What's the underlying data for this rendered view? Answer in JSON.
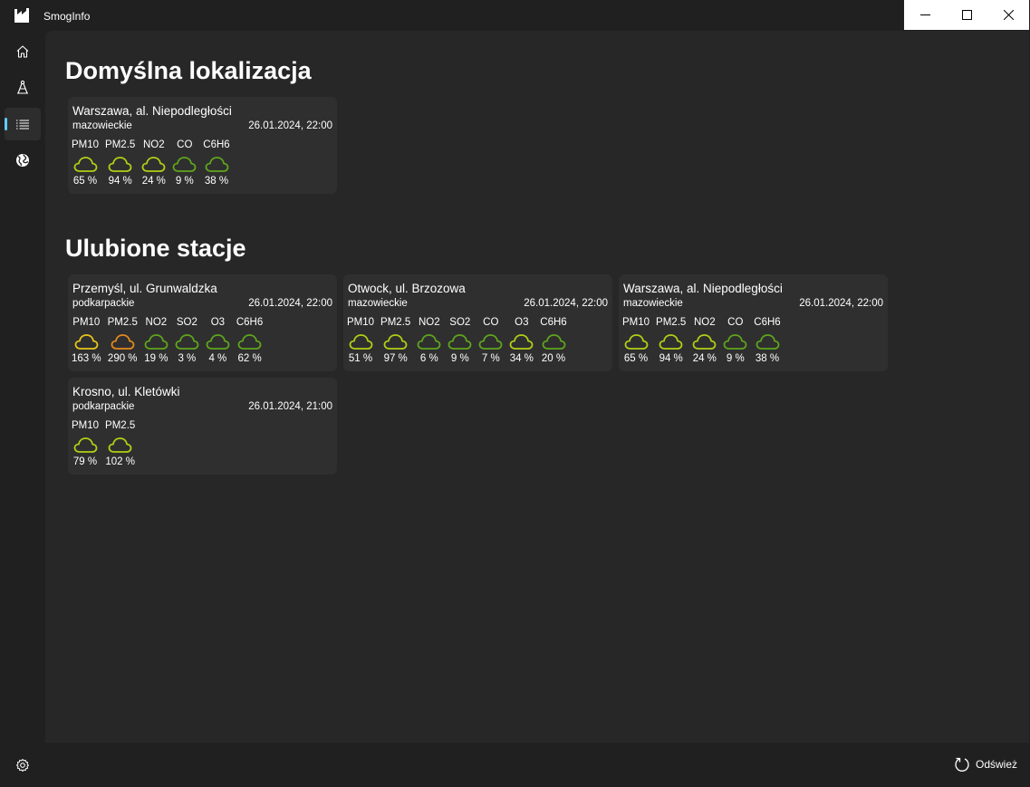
{
  "app": {
    "title": "SmogInfo"
  },
  "nav": [
    {
      "icon": "home-icon"
    },
    {
      "icon": "station-icon"
    },
    {
      "icon": "list-icon"
    },
    {
      "icon": "globe-icon"
    }
  ],
  "colors": {
    "accent": "#60cdff",
    "good": "#5fa51c",
    "moderate": "#b2ce16",
    "warning": "#e8c61a",
    "bad": "#e38a1c"
  },
  "default_section": {
    "title": "Domyślna lokalizacja",
    "cards": [
      {
        "name": "Warszawa, al. Niepodległości",
        "region": "mazowieckie",
        "time": "26.01.2024, 22:00",
        "params": [
          {
            "name": "PM10",
            "value": "65 %",
            "color": "#b2ce16"
          },
          {
            "name": "PM2.5",
            "value": "94 %",
            "color": "#b2ce16"
          },
          {
            "name": "NO2",
            "value": "24 %",
            "color": "#b2ce16"
          },
          {
            "name": "CO",
            "value": "9 %",
            "color": "#5fa51c"
          },
          {
            "name": "C6H6",
            "value": "38 %",
            "color": "#5fa51c"
          }
        ]
      }
    ]
  },
  "favorites_section": {
    "title": "Ulubione stacje",
    "cards": [
      {
        "name": "Przemyśl, ul. Grunwaldzka",
        "region": "podkarpackie",
        "time": "26.01.2024, 22:00",
        "params": [
          {
            "name": "PM10",
            "value": "163 %",
            "color": "#e8c61a"
          },
          {
            "name": "PM2.5",
            "value": "290 %",
            "color": "#e38a1c"
          },
          {
            "name": "NO2",
            "value": "19 %",
            "color": "#5fa51c"
          },
          {
            "name": "SO2",
            "value": "3 %",
            "color": "#5fa51c"
          },
          {
            "name": "O3",
            "value": "4 %",
            "color": "#5fa51c"
          },
          {
            "name": "C6H6",
            "value": "62 %",
            "color": "#5fa51c"
          }
        ]
      },
      {
        "name": "Otwock, ul. Brzozowa",
        "region": "mazowieckie",
        "time": "26.01.2024, 22:00",
        "params": [
          {
            "name": "PM10",
            "value": "51 %",
            "color": "#b2ce16"
          },
          {
            "name": "PM2.5",
            "value": "97 %",
            "color": "#b2ce16"
          },
          {
            "name": "NO2",
            "value": "6 %",
            "color": "#5fa51c"
          },
          {
            "name": "SO2",
            "value": "9 %",
            "color": "#5fa51c"
          },
          {
            "name": "CO",
            "value": "7 %",
            "color": "#5fa51c"
          },
          {
            "name": "O3",
            "value": "34 %",
            "color": "#b2ce16"
          },
          {
            "name": "C6H6",
            "value": "20 %",
            "color": "#5fa51c"
          }
        ]
      },
      {
        "name": "Warszawa, al. Niepodległości",
        "region": "mazowieckie",
        "time": "26.01.2024, 22:00",
        "params": [
          {
            "name": "PM10",
            "value": "65 %",
            "color": "#b2ce16"
          },
          {
            "name": "PM2.5",
            "value": "94 %",
            "color": "#b2ce16"
          },
          {
            "name": "NO2",
            "value": "24 %",
            "color": "#b2ce16"
          },
          {
            "name": "CO",
            "value": "9 %",
            "color": "#5fa51c"
          },
          {
            "name": "C6H6",
            "value": "38 %",
            "color": "#5fa51c"
          }
        ]
      },
      {
        "name": "Krosno, ul. Kletówki",
        "region": "podkarpackie",
        "time": "26.01.2024, 21:00",
        "params": [
          {
            "name": "PM10",
            "value": "79 %",
            "color": "#b2ce16"
          },
          {
            "name": "PM2.5",
            "value": "102 %",
            "color": "#b2ce16"
          }
        ]
      }
    ]
  },
  "bottom": {
    "refresh_label": "Odśwież",
    "settings_icon": "gear-icon",
    "refresh_icon": "refresh-icon"
  }
}
